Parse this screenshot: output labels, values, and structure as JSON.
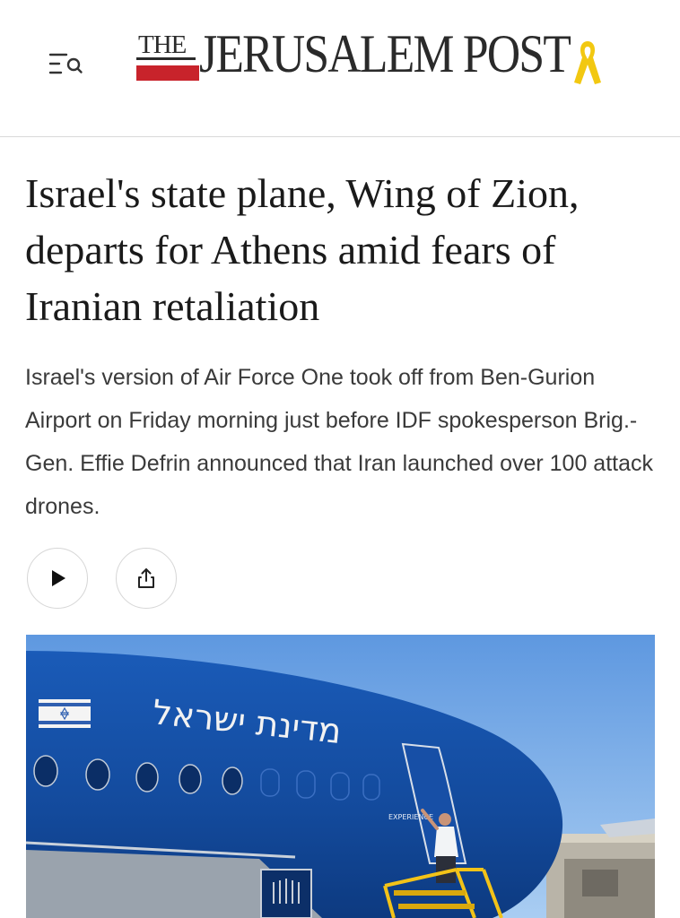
{
  "header": {
    "menu_icon": "menu-search-icon",
    "logo": {
      "the": "THE",
      "name": "JERUSALEM POST",
      "ribbon_icon": "yellow-ribbon-icon",
      "colors": {
        "text": "#2a2a2a",
        "red_bar": "#c8232b",
        "ribbon": "#f2c811"
      }
    }
  },
  "article": {
    "headline": "Israel's state plane, Wing of Zion, departs for Athens amid fears of Iranian retaliation",
    "summary": "Israel's version of Air Force One took off from Ben-Gurion Airport on Friday morning just before IDF spokesperson Brig.-Gen. Effie Defrin announced that Iran launched over 100 attack drones.",
    "actions": {
      "play_icon": "play-icon",
      "share_icon": "share-icon"
    }
  },
  "hero_image": {
    "fuselage_text": "מדינת ישראל",
    "door_text": "EXPERIENCE",
    "colors": {
      "sky": "#6aa3e6",
      "fuselage": "#1650a8",
      "stairs": "#f3c318"
    }
  }
}
